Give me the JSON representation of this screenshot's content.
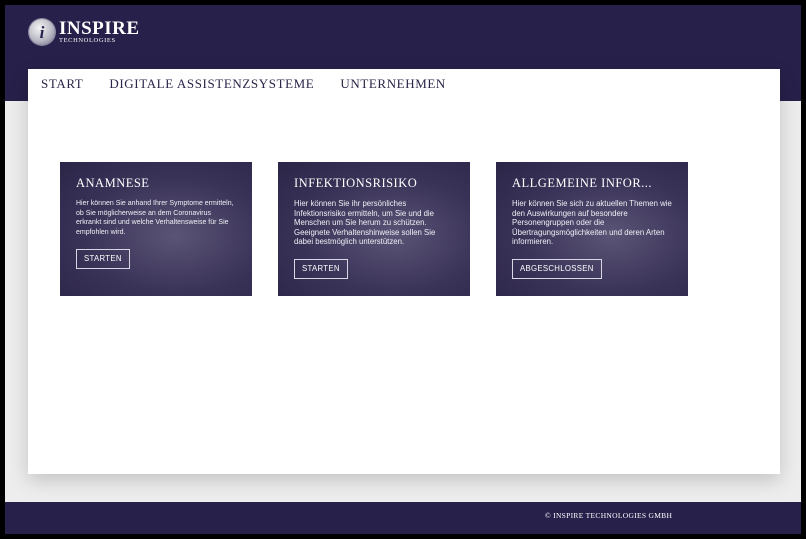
{
  "brand": {
    "mark": "i",
    "name": "INSPIRE",
    "subtitle": "TECHNOLOGIES"
  },
  "nav": {
    "items": [
      {
        "label": "START"
      },
      {
        "label": "DIGITALE ASSISTENZSYSTEME"
      },
      {
        "label": "UNTERNEHMEN"
      }
    ]
  },
  "cards": [
    {
      "title": "ANAMNESE",
      "text": "Hier können Sie anhand Ihrer Symptome ermitteln, ob Sie möglicherweise an dem Coronavirus erkrankt sind und welche Verhaltensweise für Sie empfohlen wird.",
      "button": "STARTEN"
    },
    {
      "title": "INFEKTIONSRISIKO",
      "text": "Hier können Sie ihr persönliches Infektionsrisiko ermitteln, um Sie und die Menschen um Sie herum zu schützen. Geeignete Verhaltenshinweise sollen Sie dabei bestmöglich unterstützen.",
      "button": "STARTEN"
    },
    {
      "title": "ALLGEMEINE INFOR...",
      "text": "Hier können Sie sich zu aktuellen Themen wie den Auswirkungen auf besondere Personengruppen oder die Übertragungsmöglichkeiten und deren Arten informieren.",
      "button": "ABGESCHLOSSEN"
    }
  ],
  "footer": {
    "text": "© INSPIRE TECHNOLOGIES GMBH"
  },
  "colors": {
    "header": "#27204a",
    "card": "#3a3358",
    "content": "#ffffff",
    "page": "#ededed"
  }
}
